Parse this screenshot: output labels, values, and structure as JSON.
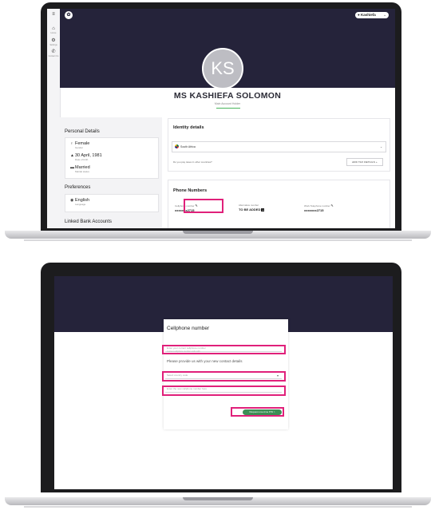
{
  "profile": {
    "rail": [
      {
        "label": "Home",
        "icon": "home-icon"
      },
      {
        "label": "Settings",
        "icon": "gear-icon"
      },
      {
        "label": "Contact Us",
        "icon": "phone-icon"
      }
    ],
    "user_chip": "Kashiefa",
    "avatar_initials": "KS",
    "name": "MS KASHIEFA SOLOMON",
    "role": "Main Account Holder",
    "personal_details": {
      "title": "Personal Details",
      "gender": "Female",
      "gender_label": "Gender",
      "dob": "30 April, 1981",
      "dob_label": "Date of birth",
      "marital": "Married",
      "marital_label": "Marital status"
    },
    "preferences": {
      "title": "Preferences",
      "language": "English",
      "language_label": "Language"
    },
    "linked_title": "Linked Bank Accounts",
    "identity": {
      "title": "Identity details",
      "country": "South Africa",
      "question": "Do you pay taxes in other countries?",
      "tax_button": "ADD TAX DETAILS +"
    },
    "phone": {
      "title": "Phone Numbers",
      "cell_label": "Cellphone number",
      "cell_value": "xxxxxxx2715",
      "alt_label": "Alternative number",
      "alt_value": "TO BE ADDED",
      "work_label": "Work Telephone number",
      "work_value": "xxxxxxx2715"
    }
  },
  "cellphone_modal": {
    "title": "Cellphone number",
    "current_placeholder": "Enter your current cellphone number",
    "current_sub": "Current cellphone number ends with",
    "caption": "Please provide us with your new contact details",
    "select_placeholder": "Select country code",
    "new_placeholder": "Enter the new cellphone number here",
    "submit_label": "Request one-time PIN",
    "submit_arrow": ">"
  },
  "colors": {
    "band": "#25233a",
    "highlight": "#e0207a",
    "accent_green": "#48b45c"
  }
}
